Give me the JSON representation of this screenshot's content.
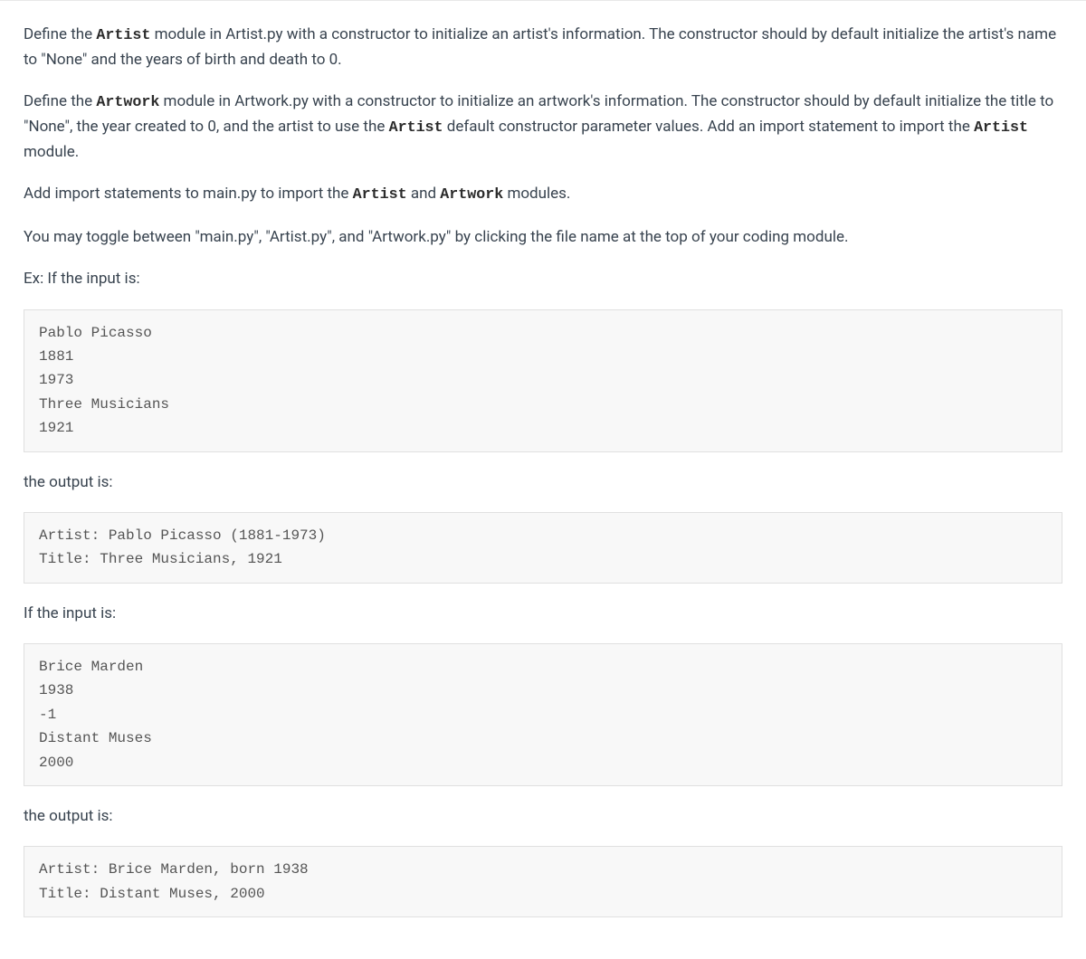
{
  "paragraphs": {
    "p1": {
      "seg1": "Define the ",
      "code1": "Artist",
      "seg2": " module in Artist.py with a constructor to initialize an artist's information. The constructor should by default initialize the artist's name to \"None\" and the years of birth and death to 0."
    },
    "p2": {
      "seg1": "Define the ",
      "code1": "Artwork",
      "seg2": " module in Artwork.py with a constructor to initialize an artwork's information. The constructor should by default initialize the title to \"None\", the year created to 0, and the artist to use the ",
      "code2": "Artist",
      "seg3": " default constructor parameter values. Add an import statement to import the ",
      "code3": "Artist",
      "seg4": " module."
    },
    "p3": {
      "seg1": "Add import statements to main.py to import the ",
      "code1": "Artist",
      "seg2": " and ",
      "code2": "Artwork",
      "seg3": " modules."
    },
    "p4": {
      "seg1": "You may toggle between \"main.py\", \"Artist.py\", and \"Artwork.py\" by clicking the file name at the top of your coding module."
    },
    "p5": {
      "seg1": "Ex: If the input is:"
    },
    "p6": {
      "seg1": "the output is:"
    },
    "p7": {
      "seg1": "If the input is:"
    },
    "p8": {
      "seg1": "the output is:"
    }
  },
  "code_blocks": {
    "input1": "Pablo Picasso\n1881\n1973\nThree Musicians\n1921",
    "output1": "Artist: Pablo Picasso (1881-1973)\nTitle: Three Musicians, 1921",
    "input2": "Brice Marden\n1938\n-1\nDistant Muses\n2000",
    "output2": "Artist: Brice Marden, born 1938\nTitle: Distant Muses, 2000"
  }
}
